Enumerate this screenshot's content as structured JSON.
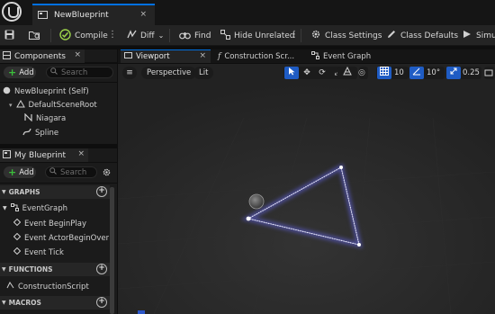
{
  "titlebar": {
    "logo": "unreal-logo",
    "tab_label": "NewBlueprint",
    "tab_close": "×"
  },
  "toolbar": {
    "compile_label": "Compile",
    "diff_label": "Diff",
    "find_label": "Find",
    "hide_unrelated_label": "Hide Unrelated",
    "class_settings_label": "Class Settings",
    "class_defaults_label": "Class Defaults",
    "simulation_label": "Simul",
    "kebab": "⋮"
  },
  "components": {
    "title": "Components",
    "add_label": "Add",
    "search_placeholder": "Search",
    "tree": [
      "NewBlueprint (Self)",
      "DefaultSceneRoot",
      "Niagara",
      "Spline"
    ]
  },
  "my_blueprint": {
    "title": "My Blueprint",
    "add_label": "Add",
    "search_placeholder": "Search",
    "graphs_header": "GRAPHS",
    "event_graph": "EventGraph",
    "events": [
      "Event BeginPlay",
      "Event ActorBeginOverlap",
      "Event Tick"
    ],
    "functions_header": "FUNCTIONS",
    "construction_script": "ConstructionScript",
    "macros_header": "MACROS"
  },
  "editor_tabs": [
    {
      "label": "Viewport",
      "active": true
    },
    {
      "label": "Construction Scr..."
    },
    {
      "label": "Event Graph"
    }
  ],
  "viewport": {
    "perspective_label": "Perspective",
    "lit_label": "Lit",
    "grid_snap_value": "10",
    "rotation_snap_value": "10°",
    "scale_snap_value": "0.25"
  },
  "colors": {
    "accent": "#0070e0",
    "selected_tool": "#1f5cc4",
    "add_plus": "#3bbf3b",
    "particle_glow": "#7a7cff"
  }
}
